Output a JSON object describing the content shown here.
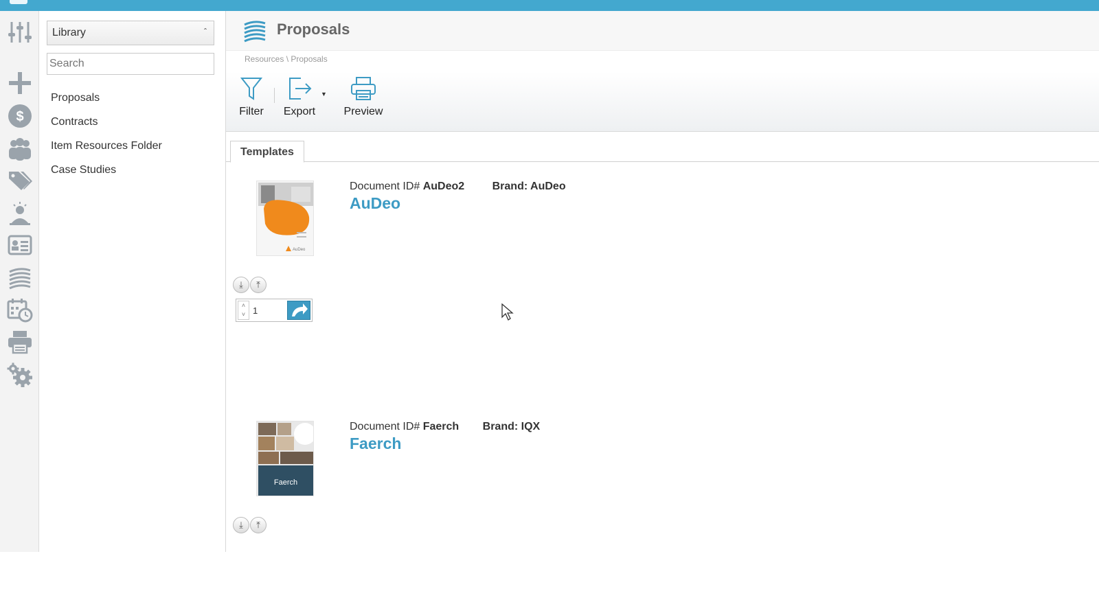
{
  "library": {
    "select_label": "Library",
    "search_placeholder": "Search",
    "items": [
      {
        "label": "Proposals"
      },
      {
        "label": "Contracts"
      },
      {
        "label": "Item Resources Folder"
      },
      {
        "label": "Case Studies"
      }
    ]
  },
  "rail_icons": [
    "sliders-icon",
    "plus-icon",
    "dollar-icon",
    "people-icon",
    "tags-icon",
    "presenter-icon",
    "contact-card-icon",
    "layers-icon",
    "calendar-clock-icon",
    "printer-icon",
    "gears-icon"
  ],
  "header": {
    "title": "Proposals",
    "breadcrumb": "Resources \\ Proposals"
  },
  "toolbar": {
    "filter_label": "Filter",
    "export_label": "Export",
    "preview_label": "Preview"
  },
  "tabs": [
    {
      "label": "Templates"
    }
  ],
  "documents": [
    {
      "id_label": "Document ID#",
      "id_value": "AuDeo2",
      "brand_label": "Brand:",
      "brand_value": "AuDeo",
      "name": "AuDeo",
      "quantity": "1"
    },
    {
      "id_label": "Document ID#",
      "id_value": "Faerch",
      "brand_label": "Brand:",
      "brand_value": "IQX",
      "name": "Faerch",
      "thumb_text": "Faerch"
    }
  ],
  "colors": {
    "topbar": "#43a8cf",
    "accent": "#3d9bc4",
    "rail_icon": "#9aa3ab"
  }
}
